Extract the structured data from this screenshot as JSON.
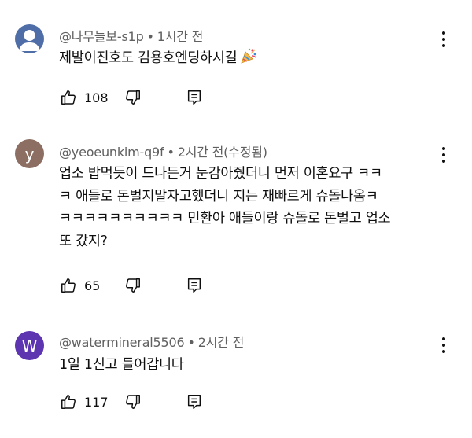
{
  "comments": [
    {
      "author": "@나무늘보-s1p",
      "time": "1시간 전",
      "text": "제발이진호도 김용호엔딩하시길",
      "emoji": "party-popper",
      "likes": "108",
      "avatar_letter": "",
      "avatar_color": "#4f6ea8"
    },
    {
      "author": "@yeoeunkim-q9f",
      "time": "2시간 전(수정됨)",
      "lines": [
        "업소 밥먹듯이 드나든거 눈감아줬더니 먼저 이혼요구 ㅋㅋ",
        "ㅋ 애들로 돈벌지말자고했더니 지는 재빠르게 슈돌나옴ㅋ",
        "ㅋㅋㅋㅋㅋㅋㅋㅋㅋㅋ 민환아 애들이랑 슈돌로 돈벌고 업소",
        "또 갔지?"
      ],
      "likes": "65",
      "avatar_letter": "y",
      "avatar_color": "#8d6e63"
    },
    {
      "author": "@watermineral5506",
      "time": "2시간 전",
      "text": "1일 1신고 들어갑니다",
      "likes": "117",
      "avatar_letter": "W",
      "avatar_color": "#5e35b1"
    }
  ],
  "meta_separator": "•"
}
